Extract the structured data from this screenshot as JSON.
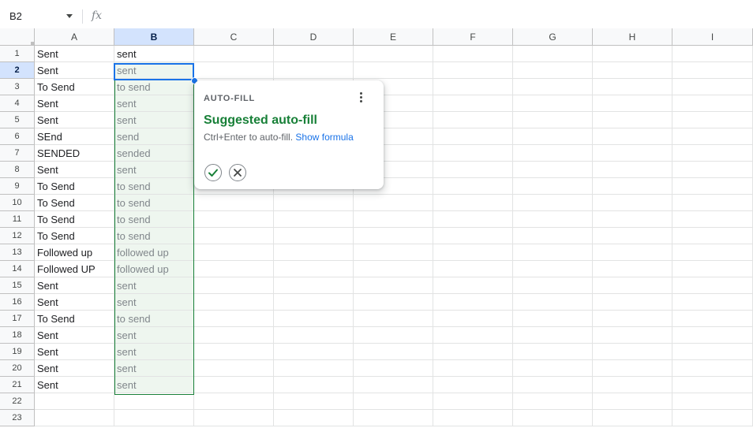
{
  "formula_bar": {
    "cell_reference": "B2",
    "fx_label": "fx",
    "formula_value": ""
  },
  "columns": [
    "A",
    "B",
    "C",
    "D",
    "E",
    "F",
    "G",
    "H",
    "I"
  ],
  "selected_column": "B",
  "selected_row": 2,
  "rows": [
    {
      "row": "1",
      "a": "Sent",
      "b": "sent"
    },
    {
      "row": "2",
      "a": "Sent",
      "b": "sent"
    },
    {
      "row": "3",
      "a": "To Send",
      "b": "to send"
    },
    {
      "row": "4",
      "a": "Sent",
      "b": "sent"
    },
    {
      "row": "5",
      "a": "Sent",
      "b": "sent"
    },
    {
      "row": "6",
      "a": "SEnd",
      "b": "send"
    },
    {
      "row": "7",
      "a": "SENDED",
      "b": "sended"
    },
    {
      "row": "8",
      "a": "Sent",
      "b": "sent"
    },
    {
      "row": "9",
      "a": "To Send",
      "b": "to send"
    },
    {
      "row": "10",
      "a": "To Send",
      "b": "to send"
    },
    {
      "row": "11",
      "a": "To Send",
      "b": "to send"
    },
    {
      "row": "12",
      "a": "To Send",
      "b": "to send"
    },
    {
      "row": "13",
      "a": "Followed up",
      "b": "followed up"
    },
    {
      "row": "14",
      "a": "Followed UP",
      "b": "followed up"
    },
    {
      "row": "15",
      "a": "Sent",
      "b": "sent"
    },
    {
      "row": "16",
      "a": "Sent",
      "b": "sent"
    },
    {
      "row": "17",
      "a": "To Send",
      "b": "to send"
    },
    {
      "row": "18",
      "a": "Sent",
      "b": "sent"
    },
    {
      "row": "19",
      "a": "Sent",
      "b": "sent"
    },
    {
      "row": "20",
      "a": "Sent",
      "b": "sent"
    },
    {
      "row": "21",
      "a": "Sent",
      "b": "sent"
    },
    {
      "row": "22",
      "a": "",
      "b": ""
    },
    {
      "row": "23",
      "a": "",
      "b": ""
    }
  ],
  "autofill_popup": {
    "section_label": "AUTO-FILL",
    "title": "Suggested auto-fill",
    "description": "Ctrl+Enter to auto-fill.",
    "link_text": "Show formula",
    "accept_icon": "checkmark-icon",
    "reject_icon": "close-icon",
    "menu_icon": "more-vert-icon"
  },
  "colors": {
    "selection_blue": "#1a73e8",
    "suggestion_green": "#188038",
    "suggestion_fill": "#eef6ef",
    "header_selected": "#d3e3fd"
  }
}
